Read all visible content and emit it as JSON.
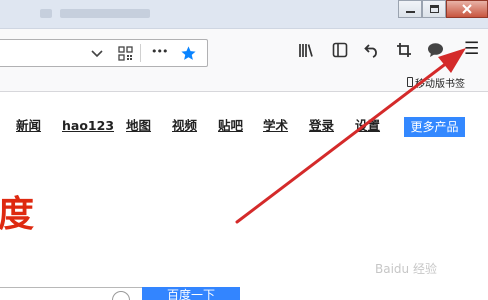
{
  "toolbar": {
    "library_icon": "library-icon",
    "sidebar_icon": "sidebar-icon",
    "undo_icon": "undo-arrow-icon",
    "screenshot_icon": "screenshot-crop-icon",
    "chat_icon": "chat-bubble-icon",
    "menu_icon": "hamburger-menu-icon",
    "menu_glyph": "☰",
    "more_glyph": "•••"
  },
  "urlbar": {
    "dropdown_icon": "chevron-down-icon",
    "qr_icon": "qr-code-icon",
    "bookmark_star_icon": "star-icon",
    "star_color": "#0a84ff"
  },
  "bookmarks": {
    "mobile_label": "移动版书签"
  },
  "baidu": {
    "nav": {
      "news": "新闻",
      "hao123": "hao123",
      "map": "地图",
      "video": "视频",
      "tieba": "贴吧",
      "xueshu": "学术",
      "login": "登录",
      "settings": "设置",
      "more_products": "更多产品"
    },
    "logo_fragment": "度",
    "search_button": "百度一下",
    "watermark": "Baidu 经验"
  },
  "annotation": {
    "arrow_color": "#d42a2a"
  }
}
